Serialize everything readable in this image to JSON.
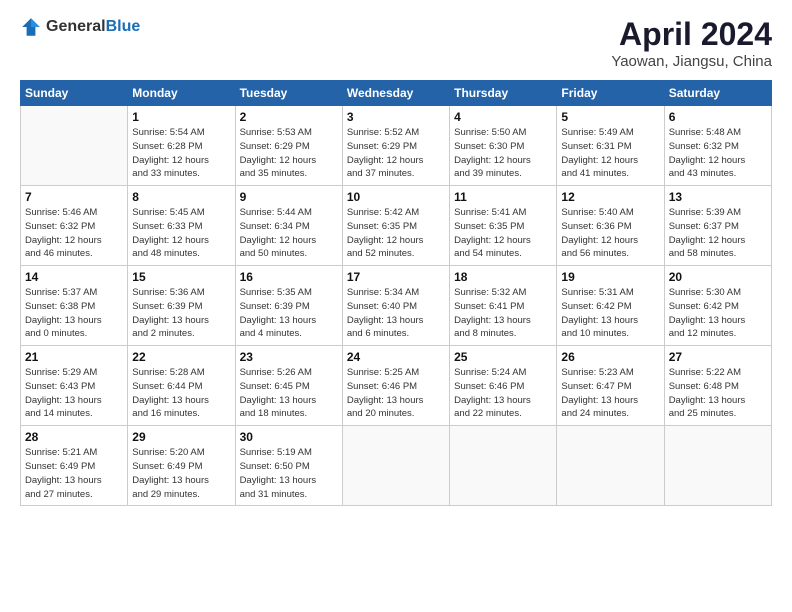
{
  "header": {
    "logo_general": "General",
    "logo_blue": "Blue",
    "month": "April 2024",
    "location": "Yaowan, Jiangsu, China"
  },
  "weekdays": [
    "Sunday",
    "Monday",
    "Tuesday",
    "Wednesday",
    "Thursday",
    "Friday",
    "Saturday"
  ],
  "weeks": [
    [
      {
        "day": "",
        "info": ""
      },
      {
        "day": "1",
        "info": "Sunrise: 5:54 AM\nSunset: 6:28 PM\nDaylight: 12 hours\nand 33 minutes."
      },
      {
        "day": "2",
        "info": "Sunrise: 5:53 AM\nSunset: 6:29 PM\nDaylight: 12 hours\nand 35 minutes."
      },
      {
        "day": "3",
        "info": "Sunrise: 5:52 AM\nSunset: 6:29 PM\nDaylight: 12 hours\nand 37 minutes."
      },
      {
        "day": "4",
        "info": "Sunrise: 5:50 AM\nSunset: 6:30 PM\nDaylight: 12 hours\nand 39 minutes."
      },
      {
        "day": "5",
        "info": "Sunrise: 5:49 AM\nSunset: 6:31 PM\nDaylight: 12 hours\nand 41 minutes."
      },
      {
        "day": "6",
        "info": "Sunrise: 5:48 AM\nSunset: 6:32 PM\nDaylight: 12 hours\nand 43 minutes."
      }
    ],
    [
      {
        "day": "7",
        "info": "Sunrise: 5:46 AM\nSunset: 6:32 PM\nDaylight: 12 hours\nand 46 minutes."
      },
      {
        "day": "8",
        "info": "Sunrise: 5:45 AM\nSunset: 6:33 PM\nDaylight: 12 hours\nand 48 minutes."
      },
      {
        "day": "9",
        "info": "Sunrise: 5:44 AM\nSunset: 6:34 PM\nDaylight: 12 hours\nand 50 minutes."
      },
      {
        "day": "10",
        "info": "Sunrise: 5:42 AM\nSunset: 6:35 PM\nDaylight: 12 hours\nand 52 minutes."
      },
      {
        "day": "11",
        "info": "Sunrise: 5:41 AM\nSunset: 6:35 PM\nDaylight: 12 hours\nand 54 minutes."
      },
      {
        "day": "12",
        "info": "Sunrise: 5:40 AM\nSunset: 6:36 PM\nDaylight: 12 hours\nand 56 minutes."
      },
      {
        "day": "13",
        "info": "Sunrise: 5:39 AM\nSunset: 6:37 PM\nDaylight: 12 hours\nand 58 minutes."
      }
    ],
    [
      {
        "day": "14",
        "info": "Sunrise: 5:37 AM\nSunset: 6:38 PM\nDaylight: 13 hours\nand 0 minutes."
      },
      {
        "day": "15",
        "info": "Sunrise: 5:36 AM\nSunset: 6:39 PM\nDaylight: 13 hours\nand 2 minutes."
      },
      {
        "day": "16",
        "info": "Sunrise: 5:35 AM\nSunset: 6:39 PM\nDaylight: 13 hours\nand 4 minutes."
      },
      {
        "day": "17",
        "info": "Sunrise: 5:34 AM\nSunset: 6:40 PM\nDaylight: 13 hours\nand 6 minutes."
      },
      {
        "day": "18",
        "info": "Sunrise: 5:32 AM\nSunset: 6:41 PM\nDaylight: 13 hours\nand 8 minutes."
      },
      {
        "day": "19",
        "info": "Sunrise: 5:31 AM\nSunset: 6:42 PM\nDaylight: 13 hours\nand 10 minutes."
      },
      {
        "day": "20",
        "info": "Sunrise: 5:30 AM\nSunset: 6:42 PM\nDaylight: 13 hours\nand 12 minutes."
      }
    ],
    [
      {
        "day": "21",
        "info": "Sunrise: 5:29 AM\nSunset: 6:43 PM\nDaylight: 13 hours\nand 14 minutes."
      },
      {
        "day": "22",
        "info": "Sunrise: 5:28 AM\nSunset: 6:44 PM\nDaylight: 13 hours\nand 16 minutes."
      },
      {
        "day": "23",
        "info": "Sunrise: 5:26 AM\nSunset: 6:45 PM\nDaylight: 13 hours\nand 18 minutes."
      },
      {
        "day": "24",
        "info": "Sunrise: 5:25 AM\nSunset: 6:46 PM\nDaylight: 13 hours\nand 20 minutes."
      },
      {
        "day": "25",
        "info": "Sunrise: 5:24 AM\nSunset: 6:46 PM\nDaylight: 13 hours\nand 22 minutes."
      },
      {
        "day": "26",
        "info": "Sunrise: 5:23 AM\nSunset: 6:47 PM\nDaylight: 13 hours\nand 24 minutes."
      },
      {
        "day": "27",
        "info": "Sunrise: 5:22 AM\nSunset: 6:48 PM\nDaylight: 13 hours\nand 25 minutes."
      }
    ],
    [
      {
        "day": "28",
        "info": "Sunrise: 5:21 AM\nSunset: 6:49 PM\nDaylight: 13 hours\nand 27 minutes."
      },
      {
        "day": "29",
        "info": "Sunrise: 5:20 AM\nSunset: 6:49 PM\nDaylight: 13 hours\nand 29 minutes."
      },
      {
        "day": "30",
        "info": "Sunrise: 5:19 AM\nSunset: 6:50 PM\nDaylight: 13 hours\nand 31 minutes."
      },
      {
        "day": "",
        "info": ""
      },
      {
        "day": "",
        "info": ""
      },
      {
        "day": "",
        "info": ""
      },
      {
        "day": "",
        "info": ""
      }
    ]
  ]
}
